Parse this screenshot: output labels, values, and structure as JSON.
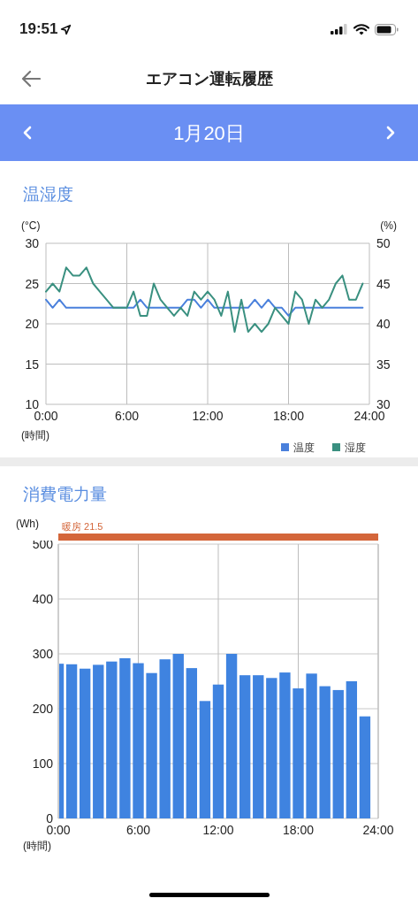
{
  "status_bar": {
    "time": "19:51"
  },
  "header": {
    "title": "エアコン運転履歴"
  },
  "date_bar": {
    "date": "1月20日"
  },
  "sections": [
    {
      "title": "温湿度",
      "left_unit": "(°C)",
      "right_unit": "(%)",
      "x_unit": "(時間)",
      "chart_data": {
        "type": "line",
        "grid": true,
        "legend": true,
        "x": [
          0,
          0.5,
          1,
          1.5,
          2,
          2.5,
          3,
          3.5,
          4,
          4.5,
          5,
          5.5,
          6,
          6.5,
          7,
          7.5,
          8,
          8.5,
          9,
          9.5,
          10,
          10.5,
          11,
          11.5,
          12,
          12.5,
          13,
          13.5,
          14,
          14.5,
          15,
          15.5,
          16,
          16.5,
          17,
          17.5,
          18,
          18.5,
          19,
          19.5,
          20,
          20.5,
          21,
          21.5,
          22,
          22.5,
          23,
          23.5
        ],
        "xlim": [
          0,
          24
        ],
        "ylim": [
          10,
          30
        ],
        "y2lim": [
          30,
          50
        ],
        "yticks": [
          10,
          15,
          20,
          25,
          30
        ],
        "y2ticks": [
          30,
          35,
          40,
          45,
          50
        ],
        "xticks": [
          {
            "value": 0,
            "label": "0:00"
          },
          {
            "value": 6,
            "label": "6:00"
          },
          {
            "value": 12,
            "label": "12:00"
          },
          {
            "value": 18,
            "label": "18:00"
          },
          {
            "value": 24,
            "label": "24:00"
          }
        ],
        "series": [
          {
            "name": "温度",
            "color": "#4a80dc",
            "values": [
              23,
              22,
              23,
              22,
              22,
              22,
              22,
              22,
              22,
              22,
              22,
              22,
              22,
              22,
              23,
              22,
              22,
              22,
              22,
              22,
              22,
              23,
              23,
              22,
              23,
              22,
              22,
              22,
              22,
              22,
              22,
              23,
              22,
              23,
              22,
              22,
              21,
              22,
              22,
              22,
              22,
              22,
              22,
              22,
              22,
              22,
              22,
              22
            ]
          },
          {
            "name": "湿度",
            "color": "#3a9080",
            "axis": "y2",
            "values": [
              44,
              45,
              44,
              47,
              46,
              46,
              47,
              45,
              44,
              43,
              42,
              42,
              42,
              44,
              41,
              41,
              45,
              43,
              42,
              41,
              42,
              41,
              44,
              43,
              44,
              43,
              41,
              44,
              39,
              43,
              39,
              40,
              39,
              40,
              42,
              41,
              40,
              44,
              43,
              40,
              43,
              42,
              43,
              45,
              46,
              43,
              43,
              45
            ]
          }
        ]
      }
    },
    {
      "title": "消費電力量",
      "left_unit": "(Wh)",
      "x_unit": "(時間)",
      "mode_bar": {
        "label": "暖房 21.5",
        "color": "#d4663a"
      },
      "chart_data": {
        "type": "bar",
        "grid": true,
        "x": [
          0,
          1,
          2,
          3,
          4,
          5,
          6,
          7,
          8,
          9,
          10,
          11,
          12,
          13,
          14,
          15,
          16,
          17,
          18,
          19,
          20,
          21,
          22,
          23
        ],
        "xlim": [
          0,
          24
        ],
        "ylim": [
          0,
          500
        ],
        "yticks": [
          0,
          100,
          200,
          300,
          400,
          500
        ],
        "xticks": [
          {
            "value": 0,
            "label": "0:00"
          },
          {
            "value": 6,
            "label": "6:00"
          },
          {
            "value": 12,
            "label": "12:00"
          },
          {
            "value": 18,
            "label": "18:00"
          },
          {
            "value": 24,
            "label": "24:00"
          }
        ],
        "series": [
          {
            "color": "#3f83e0",
            "values": [
              282,
              281,
              273,
              280,
              286,
              292,
              283,
              265,
              290,
              300,
              274,
              214,
              244,
              300,
              261,
              261,
              256,
              266,
              237,
              264,
              241,
              234,
              250,
              186
            ]
          }
        ]
      }
    }
  ]
}
